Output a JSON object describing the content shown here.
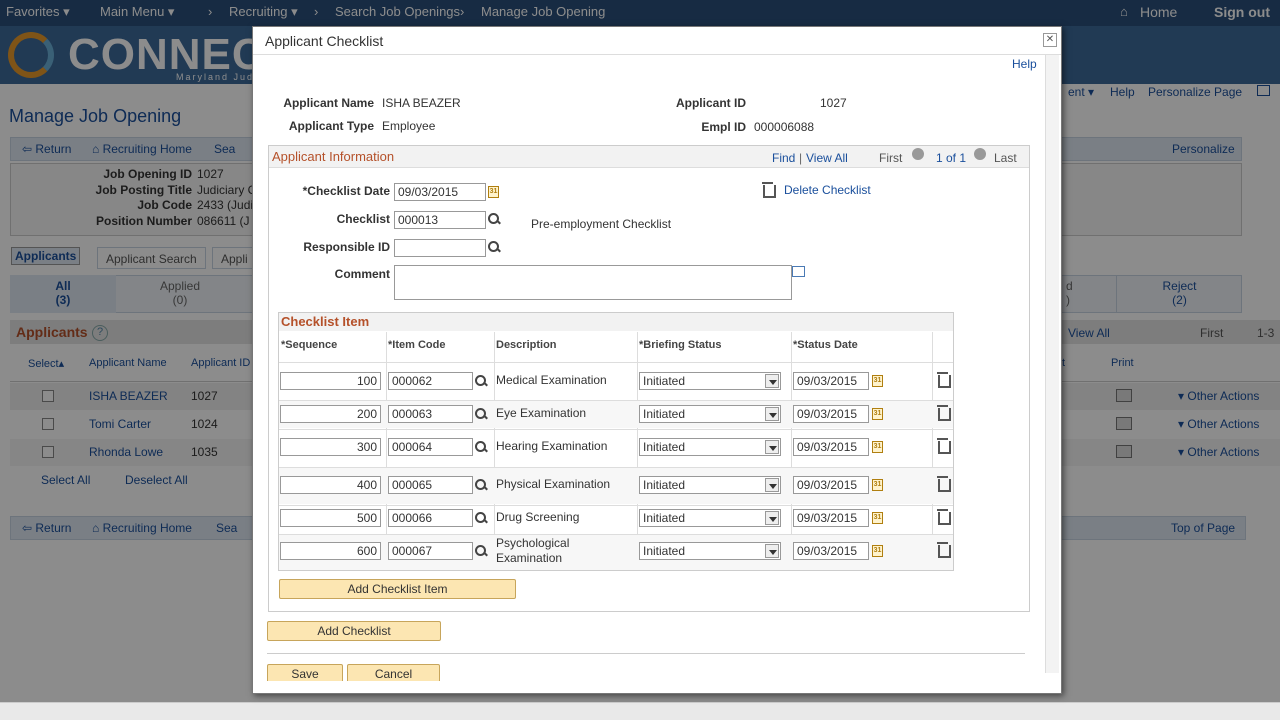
{
  "topnav": {
    "favorites": "Favorites",
    "main_menu": "Main Menu",
    "crumb1": "Recruiting",
    "crumb2": "Search Job Openings",
    "crumb3": "Manage Job Opening",
    "home": "Home",
    "signout": "Sign out"
  },
  "banner": {
    "logo": "CONNEC",
    "sub": "Maryland Judi"
  },
  "bg": {
    "right_links": {
      "ent": "ent",
      "help": "Help",
      "personalize_page": "Personalize Page"
    },
    "page_title": "Manage Job Opening",
    "toolbar": {
      "return": "Return",
      "recruiting_home": "Recruiting Home",
      "search": "Sea",
      "personalize": "Personalize"
    },
    "fields": [
      {
        "label": "Job Opening ID",
        "value": "1027"
      },
      {
        "label": "Job Posting Title",
        "value": "Judiciary C"
      },
      {
        "label": "Job Code",
        "value": "2433 (Judi"
      },
      {
        "label": "Position Number",
        "value": "086611 (J"
      }
    ],
    "tabs": {
      "applicants": "Applicants",
      "applicant_search": "Applicant Search",
      "appli": "Appli"
    },
    "status_tabs": [
      {
        "label": "All",
        "count": "(3)"
      },
      {
        "label": "Applied",
        "count": "(0)"
      },
      {
        "label": "d",
        "count": ")"
      },
      {
        "label": "Reject",
        "count": "(2)"
      }
    ],
    "applicants_header": "Applicants",
    "grid_nav": {
      "view_all": "View All",
      "first": "First",
      "range": "1-3"
    },
    "cols": {
      "select": "Select",
      "name": "Applicant Name",
      "id": "Applicant ID",
      "t": "t",
      "print": "Print"
    },
    "rows": [
      {
        "name": "ISHA BEAZER",
        "id": "1027",
        "action": "Other Actions"
      },
      {
        "name": "Tomi Carter",
        "id": "1024",
        "action": "Other Actions"
      },
      {
        "name": "Rhonda Lowe",
        "id": "1035",
        "action": "Other Actions"
      }
    ],
    "select_all": "Select All",
    "deselect_all": "Deselect All",
    "bottom": {
      "return": "Return",
      "recruiting_home": "Recruiting Home",
      "search": "Sea",
      "top": "Top of Page"
    }
  },
  "modal": {
    "title": "Applicant Checklist",
    "help": "Help",
    "applicant_name_label": "Applicant Name",
    "applicant_name": "ISHA BEAZER",
    "applicant_id_label": "Applicant ID",
    "applicant_id": "1027",
    "applicant_type_label": "Applicant Type",
    "applicant_type": "Employee",
    "empl_id_label": "Empl ID",
    "empl_id": "000006088",
    "info_header": "Applicant Information",
    "find": "Find",
    "view_all": "View All",
    "first": "First",
    "one_of_one": "1 of 1",
    "last": "Last",
    "checklist_date_label": "*Checklist Date",
    "checklist_date": "09/03/2015",
    "delete_checklist": "Delete Checklist",
    "checklist_label": "Checklist",
    "checklist": "000013",
    "checklist_desc": "Pre-employment Checklist",
    "responsible_label": "Responsible ID",
    "responsible": "",
    "comment_label": "Comment",
    "comment": "",
    "item_header": "Checklist Item",
    "cols": {
      "seq": "*Sequence",
      "code": "*Item Code",
      "desc": "Description",
      "brief": "*Briefing Status",
      "date": "*Status Date"
    },
    "items": [
      {
        "seq": "100",
        "code": "000062",
        "desc": "Medical Examination",
        "status": "Initiated",
        "date": "09/03/2015"
      },
      {
        "seq": "200",
        "code": "000063",
        "desc": "Eye Examination",
        "status": "Initiated",
        "date": "09/03/2015"
      },
      {
        "seq": "300",
        "code": "000064",
        "desc": "Hearing Examination",
        "status": "Initiated",
        "date": "09/03/2015"
      },
      {
        "seq": "400",
        "code": "000065",
        "desc": "Physical Examination",
        "status": "Initiated",
        "date": "09/03/2015"
      },
      {
        "seq": "500",
        "code": "000066",
        "desc": "Drug Screening",
        "status": "Initiated",
        "date": "09/03/2015"
      },
      {
        "seq": "600",
        "code": "000067",
        "desc": "Psychological Examination",
        "status": "Initiated",
        "date": "09/03/2015"
      }
    ],
    "add_item": "Add Checklist Item",
    "add_checklist": "Add Checklist",
    "save": "Save",
    "cancel": "Cancel"
  },
  "colors": {
    "nav": "#2b4f7a",
    "banner": "#3d6a9a",
    "button": "#fce6b2",
    "link": "#1a4f9c",
    "header_text": "#b5512a"
  }
}
